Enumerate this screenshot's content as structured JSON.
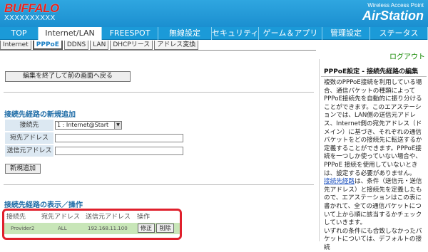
{
  "header": {
    "logo": "BUFFALO",
    "model": "XXXXXXXXXX",
    "tagline": "Wireless Access Point",
    "brand": "AirStation"
  },
  "main_tabs": [
    {
      "label": "TOP"
    },
    {
      "label": "Internet/LAN"
    },
    {
      "label": "FREESPOT"
    },
    {
      "label": "無線設定"
    },
    {
      "label": "セキュリティ"
    },
    {
      "label": "ゲーム＆アプリ"
    },
    {
      "label": "管理設定"
    },
    {
      "label": "ステータス"
    }
  ],
  "sub_tabs": [
    {
      "label": "Internet"
    },
    {
      "label": "PPPoE"
    },
    {
      "label": "DDNS"
    },
    {
      "label": "LAN"
    },
    {
      "label": "DHCPリース"
    },
    {
      "label": "アドレス変換"
    }
  ],
  "logout": "ログアウト",
  "back_button": "編集を終了して前の画面へ戻る",
  "new_route": {
    "title": "接続先経路の新規追加",
    "connection_label": "接続先",
    "connection_value": "1 : Internet@Start",
    "dest_label": "宛先アドレス",
    "src_label": "送信元アドレス",
    "add_button": "新規追加"
  },
  "route_list": {
    "title": "接続先経路の表示／操作",
    "headers": [
      "接続先",
      "宛先アドレス",
      "送信元アドレス",
      "操作"
    ],
    "rows": [
      {
        "connection": "Provider2",
        "dest": "ALL",
        "src": "192.168.11.100",
        "edit": "修正",
        "delete": "削除"
      }
    ]
  },
  "help": {
    "title": "PPPoE設定 - 接続先経路の編集",
    "para1": "複数のPPPoE接続を利用している場合、通信パケットの種類によってPPPoE接続先を自動的に振り分けることができます。このエアステーションでは、LAN側の送信元アドレス、Internet側の宛先アドレス（ドメイン）に基づき、それぞれの通信パケットをどの接続先に転送するか定義することができます。PPPoE接続を一つしか使っていない場合や、PPPoE 接続を使用していないときは、設定する必要がありません。",
    "link": "接続先経路",
    "para2": "は、条件（送信元・送信先アドレス）と接続先を定義したもので、エアステーションはこの表に書かれて、全ての通信パケットについて上から順に該当するかチェックしていきます。",
    "para3": "いずれの条件にも合致しなかったパケットについては、デフォルトの接続"
  }
}
